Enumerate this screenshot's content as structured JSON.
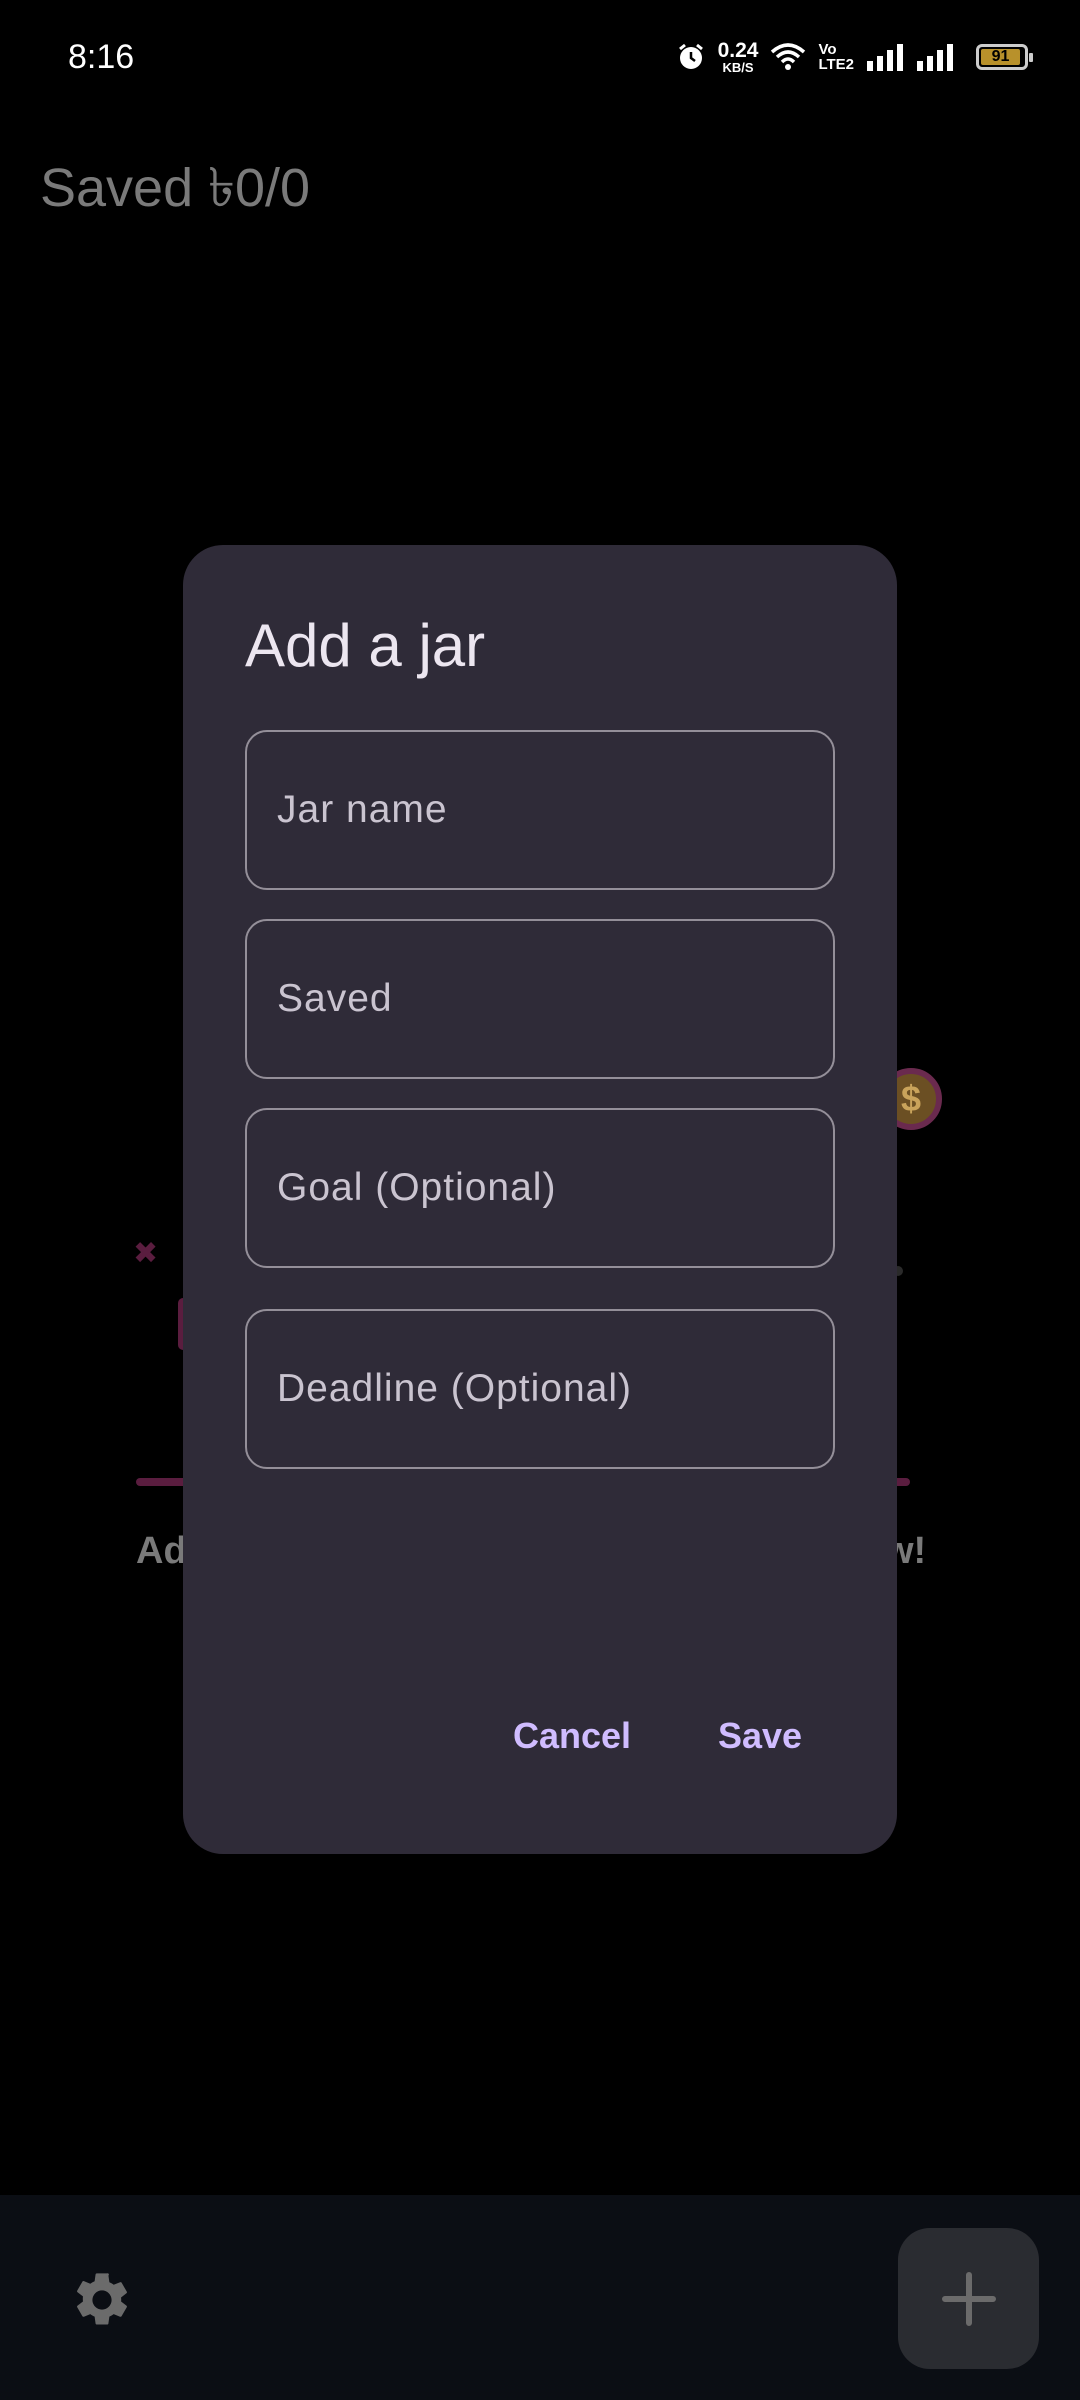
{
  "status_bar": {
    "time": "8:16",
    "net_speed_value": "0.24",
    "net_speed_unit": "KB/S",
    "volte_top": "Vo",
    "volte_bottom": "LTE2",
    "battery": "91"
  },
  "background": {
    "saved_title": "Saved ৳0/0",
    "text_left": "Ad",
    "text_right": "w!",
    "coin_symbol": "$"
  },
  "dialog": {
    "title": "Add a jar",
    "fields": [
      {
        "placeholder": "Jar name"
      },
      {
        "placeholder": "Saved"
      },
      {
        "placeholder": "Goal (Optional)"
      },
      {
        "placeholder": "Deadline (Optional)"
      }
    ],
    "cancel_label": "Cancel",
    "save_label": "Save"
  },
  "colors": {
    "dialog_bg": "#2f2b38",
    "accent": "#d0bcff",
    "bottom_bar": "#0b0e14",
    "fab": "#2a2c31"
  },
  "icons": {
    "settings": "gear-icon",
    "add": "plus-icon"
  }
}
